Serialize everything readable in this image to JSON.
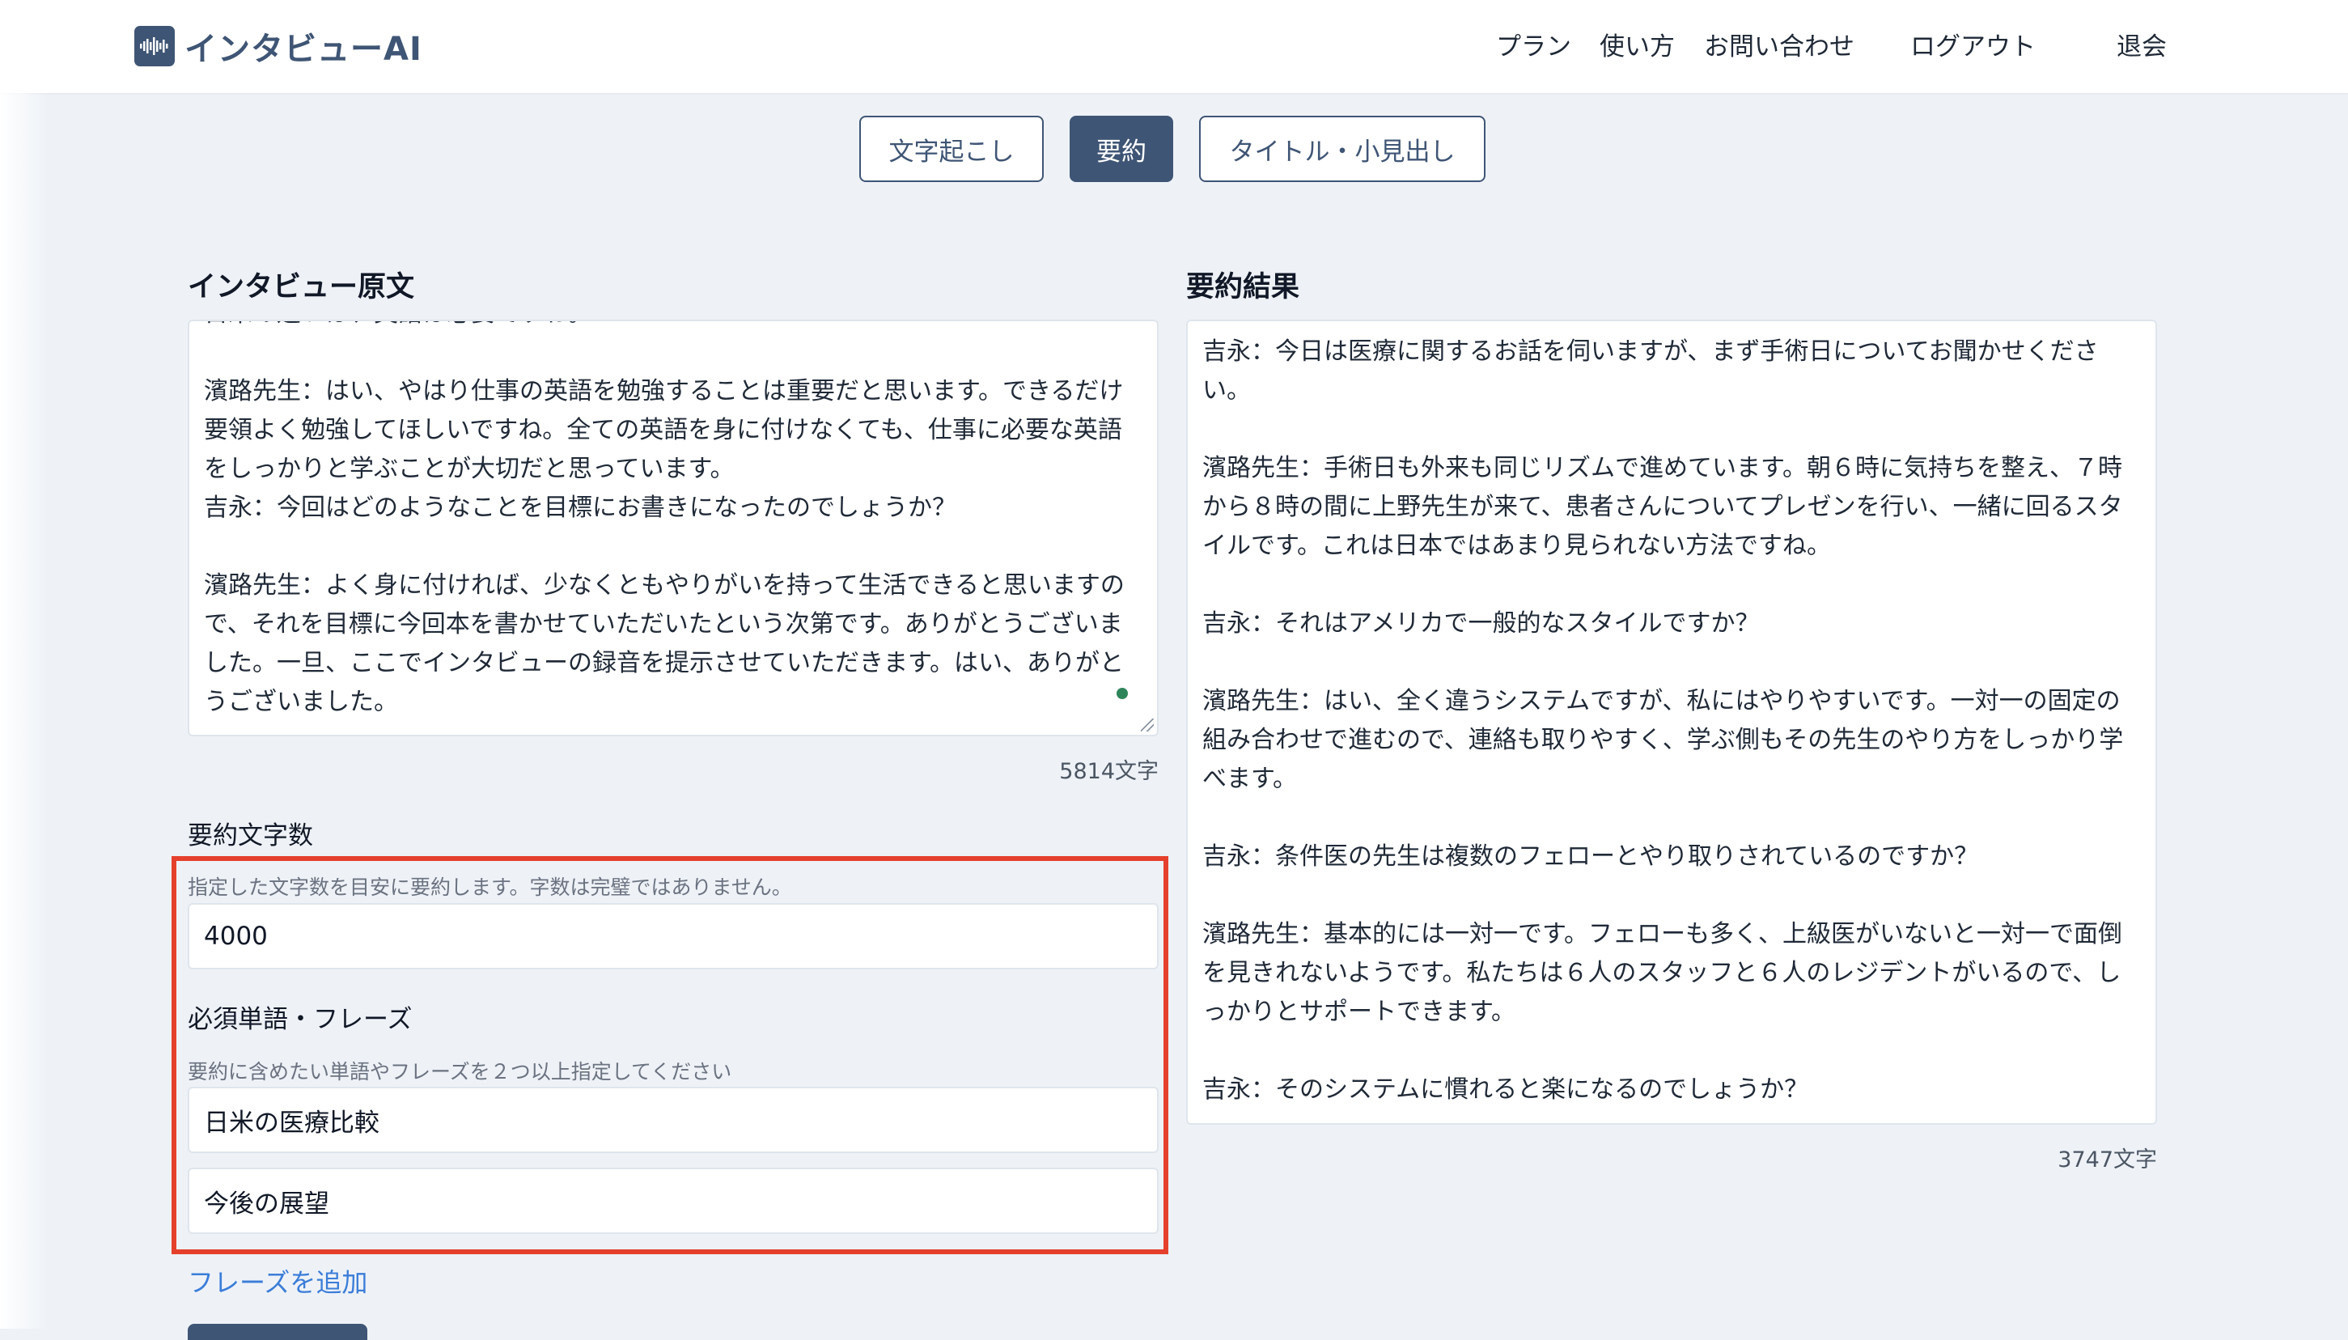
{
  "header": {
    "app_name": "インタビューAI",
    "nav": {
      "plans": "プラン",
      "howto": "使い方",
      "contact": "お問い合わせ",
      "logout": "ログアウト",
      "withdraw": "退会"
    }
  },
  "tabs": {
    "transcribe": "文字起こし",
    "summary": "要約",
    "title": "タイトル・小見出し",
    "active": "summary"
  },
  "original": {
    "title": "インタビュー原文",
    "text": "日米の違いは、英語は必要ですね。\n\n濱路先生：はい、やはり仕事の英語を勉強することは重要だと思います。できるだけ要領よく勉強してほしいですね。全ての英語を身に付けなくても、仕事に必要な英語をしっかりと学ぶことが大切だと思っています。\n吉永：今回はどのようなことを目標にお書きになったのでしょうか？\n\n濱路先生：よく身に付ければ、少なくともやりがいを持って生活できると思いますので、それを目標に今回本を書かせていただいたという次第です。ありがとうございました。一旦、ここでインタビューの録音を提示させていただきます。はい、ありがとうございました。",
    "char_count": "5814文字"
  },
  "summary_result": {
    "title": "要約結果",
    "text": "吉永：今日は医療に関するお話を伺いますが、まず手術日についてお聞かせください。\n\n濱路先生：手術日も外来も同じリズムで進めています。朝６時に気持ちを整え、７時から８時の間に上野先生が来て、患者さんについてプレゼンを行い、一緒に回るスタイルです。これは日本ではあまり見られない方法ですね。\n\n吉永：それはアメリカで一般的なスタイルですか？\n\n濱路先生：はい、全く違うシステムですが、私にはやりやすいです。一対一の固定の組み合わせで進むので、連絡も取りやすく、学ぶ側もその先生のやり方をしっかり学べます。\n\n吉永：条件医の先生は複数のフェローとやり取りされているのですか？\n\n濱路先生：基本的には一対一です。フェローも多く、上級医がいないと一対一で面倒を見きれないようです。私たちは６人のスタッフと６人のレジデントがいるので、しっかりとサポートできます。\n\n吉永：そのシステムに慣れると楽になるのでしょうか？",
    "char_count": "3747文字"
  },
  "summary_length": {
    "label": "要約文字数",
    "hint": "指定した文字数を目安に要約します。字数は完璧ではありません。",
    "value": "4000"
  },
  "phrases": {
    "label": "必須単語・フレーズ",
    "hint": "要約に含めたい単語やフレーズを２つ以上指定してください",
    "items": [
      "日米の医療比較",
      "今後の展望"
    ],
    "add_label": "フレーズを追加"
  },
  "colors": {
    "primary": "#3f5575",
    "highlight": "#e5402c",
    "link": "#3b7dd8"
  }
}
